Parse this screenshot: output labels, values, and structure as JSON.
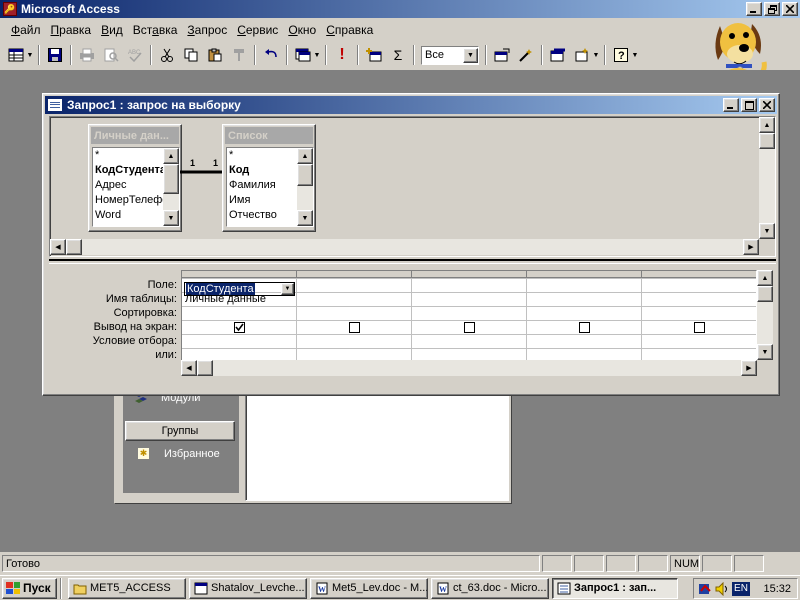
{
  "app": {
    "title": "Microsoft Access",
    "icon_label": "🔑"
  },
  "menu": {
    "items": [
      {
        "prefix": "",
        "key": "Ф",
        "rest": "айл"
      },
      {
        "prefix": "",
        "key": "П",
        "rest": "равка"
      },
      {
        "prefix": "",
        "key": "В",
        "rest": "ид"
      },
      {
        "prefix": "Вст",
        "key": "а",
        "rest": "вка"
      },
      {
        "prefix": "",
        "key": "З",
        "rest": "апрос"
      },
      {
        "prefix": "",
        "key": "С",
        "rest": "ервис"
      },
      {
        "prefix": "",
        "key": "О",
        "rest": "кно"
      },
      {
        "prefix": "",
        "key": "С",
        "rest": "правка"
      }
    ]
  },
  "toolbar": {
    "top_values_combo": "Все",
    "sum_label": "Σ",
    "run_label": "!"
  },
  "query_window": {
    "title": "Запрос1 : запрос на выборку"
  },
  "tables": [
    {
      "title": "Личные дан...",
      "fields": [
        "*",
        "КодСтудента",
        "Адрес",
        "НомерТелефона",
        "Word"
      ],
      "bold_index": 1
    },
    {
      "title": "Список",
      "fields": [
        "*",
        "Код",
        "Фамилия",
        "Имя",
        "Отчество"
      ],
      "bold_index": 1
    }
  ],
  "relationship": {
    "left": "1",
    "right": "1"
  },
  "grid": {
    "row_labels": [
      "Поле:",
      "Имя таблицы:",
      "Сортировка:",
      "Вывод на экран:",
      "Условие отбора:",
      "или:"
    ],
    "columns": [
      {
        "field": "КодСтудента",
        "table": "Личные данные",
        "show": true
      },
      {
        "field": "",
        "table": "",
        "show": false
      },
      {
        "field": "",
        "table": "",
        "show": false
      },
      {
        "field": "",
        "table": "",
        "show": false
      },
      {
        "field": "",
        "table": "",
        "show": false
      }
    ]
  },
  "db_window": {
    "modules_label": "Модули",
    "groups_label": "Группы",
    "favorites_label": "Избранное"
  },
  "statusbar": {
    "text": "Готово",
    "num": "NUM"
  },
  "taskbar": {
    "start": "Пуск",
    "tasks": [
      {
        "label": "MET5_ACCESS",
        "icon": "folder",
        "active": false
      },
      {
        "label": "Shatalov_Levche...",
        "icon": "window",
        "active": false
      },
      {
        "label": "Met5_Lev.doc - M...",
        "icon": "word",
        "active": false
      },
      {
        "label": "ct_63.doc - Micro...",
        "icon": "word",
        "active": false
      },
      {
        "label": "Запрос1 : зап...",
        "icon": "query",
        "active": true
      }
    ],
    "lang": "EN",
    "clock": "15:32"
  }
}
